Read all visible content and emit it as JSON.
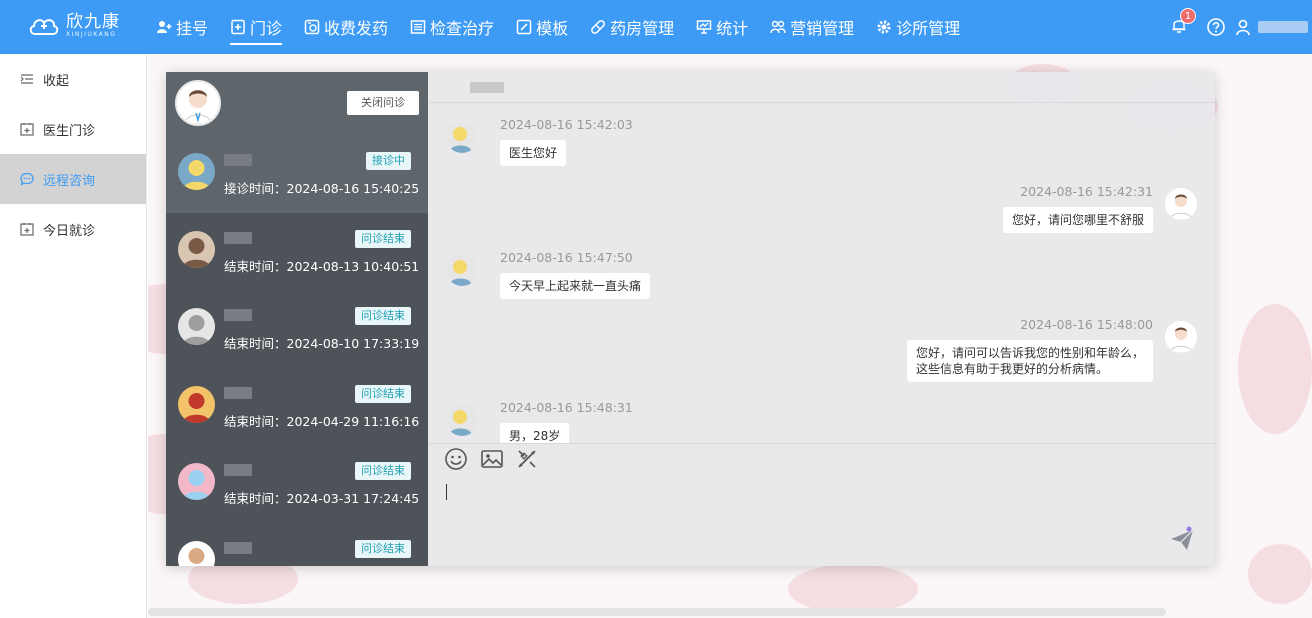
{
  "brand": {
    "name": "欣九康",
    "sub": "XINJIUKANG",
    "color": "#3d9bf5"
  },
  "nav": {
    "items": [
      {
        "label": "挂号",
        "icon": "user-add-icon",
        "active": false
      },
      {
        "label": "门诊",
        "icon": "clinic-doc-icon",
        "active": true
      },
      {
        "label": "收费发药",
        "icon": "pay-medicine-icon",
        "active": false
      },
      {
        "label": "检查治疗",
        "icon": "exam-icon",
        "active": false
      },
      {
        "label": "模板",
        "icon": "template-icon",
        "active": false
      },
      {
        "label": "药房管理",
        "icon": "pill-icon",
        "active": false
      },
      {
        "label": "统计",
        "icon": "chart-icon",
        "active": false
      },
      {
        "label": "营销管理",
        "icon": "people-icon",
        "active": false
      },
      {
        "label": "诊所管理",
        "icon": "gear-icon",
        "active": false
      }
    ],
    "notification_count": "1"
  },
  "sidebar": {
    "collapse_label": "收起",
    "items": [
      {
        "label": "医生门诊",
        "active": false
      },
      {
        "label": "远程咨询",
        "active": true
      },
      {
        "label": "今日就诊",
        "active": false
      }
    ]
  },
  "consult": {
    "close_button": "关闭问诊",
    "conversations": [
      {
        "status": "接诊中",
        "time": "接诊时间：2024-08-16 15:40:25",
        "active": true
      },
      {
        "status": "问诊结束",
        "time": "结束时间：2024-08-13 10:40:51",
        "active": false
      },
      {
        "status": "问诊结束",
        "time": "结束时间：2024-08-10 17:33:19",
        "active": false
      },
      {
        "status": "问诊结束",
        "time": "结束时间：2024-04-29 11:16:16",
        "active": false
      },
      {
        "status": "问诊结束",
        "time": "结束时间：2024-03-31 17:24:45",
        "active": false
      },
      {
        "status": "问诊结束",
        "time": "",
        "active": false
      }
    ],
    "messages": [
      {
        "side": "left",
        "time": "2024-08-16 15:42:03",
        "text": "医生您好"
      },
      {
        "side": "right",
        "time": "2024-08-16 15:42:31",
        "text": "您好，请问您哪里不舒服"
      },
      {
        "side": "left",
        "time": "2024-08-16 15:47:50",
        "text": "今天早上起来就一直头痛"
      },
      {
        "side": "right",
        "time": "2024-08-16 15:48:00",
        "text": "您好，请问可以告诉我您的性别和年龄么，\n这些信息有助于我更好的分析病情。"
      },
      {
        "side": "left",
        "time": "2024-08-16 15:48:31",
        "text": "男，28岁"
      }
    ],
    "tools": [
      "emoji-icon",
      "image-icon",
      "magic-wand-icon"
    ],
    "send_icon": "send-icon"
  }
}
